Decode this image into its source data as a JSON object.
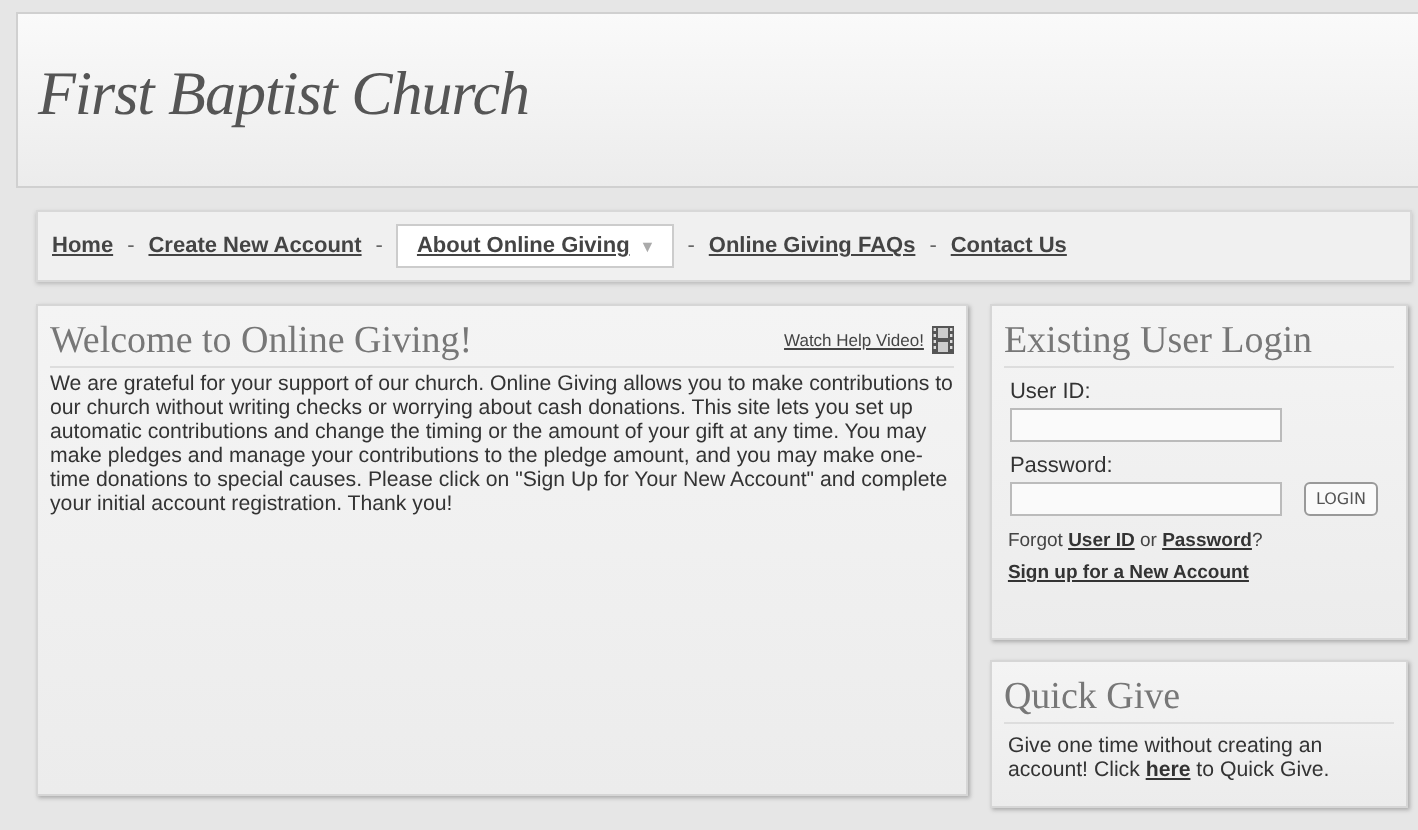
{
  "header": {
    "title": "First Baptist Church"
  },
  "nav": {
    "separator": "-",
    "items": [
      {
        "label": "Home",
        "selected": false
      },
      {
        "label": "Create New Account",
        "selected": false
      },
      {
        "label": "About Online Giving",
        "selected": true,
        "caret": "▼"
      },
      {
        "label": "Online Giving FAQs",
        "selected": false
      },
      {
        "label": "Contact Us",
        "selected": false
      }
    ]
  },
  "welcome": {
    "title": "Welcome to Online Giving!",
    "help_link": "Watch Help Video!",
    "text": "We are grateful for your support of our church. Online Giving allows you to make contributions to our church without writing checks or worrying about cash donations. This site lets you set up automatic contributions and change the timing or the amount of your gift at any time. You may make pledges and manage your contributions to the pledge amount, and you may make one-time donations to special causes. Please click on \"Sign Up for Your New Account\" and complete your initial account registration. Thank you!"
  },
  "login": {
    "title": "Existing User Login",
    "user_id_label": "User ID:",
    "password_label": "Password:",
    "button": "LOGIN",
    "forgot": {
      "before": "Forgot",
      "link1": "User ID",
      "middle": "or",
      "link2": "Password",
      "after": "?"
    },
    "signup_link": "Sign up for a New Account"
  },
  "quick_give": {
    "title": "Quick Give",
    "before": "Give one time without creating an account! Click",
    "link": "here",
    "after": "to Quick Give."
  }
}
